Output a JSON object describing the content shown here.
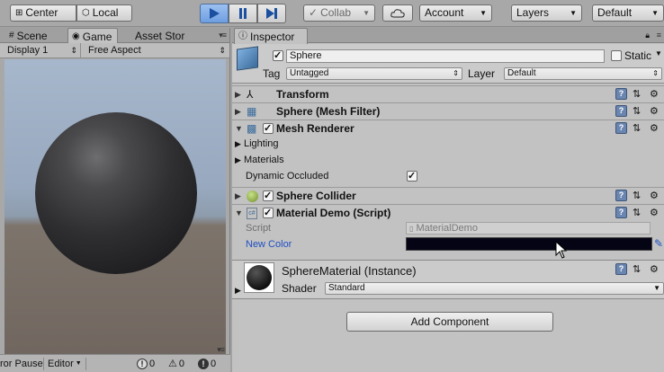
{
  "toolbar": {
    "center_label": "Center",
    "local_label": "Local",
    "collab_label": "Collab",
    "account_label": "Account",
    "layers_label": "Layers",
    "layout_label": "Default"
  },
  "game_panel": {
    "tabs": [
      "Scene",
      "Game",
      "Asset Stor"
    ],
    "display": "Display 1",
    "aspect": "Free Aspect",
    "status": {
      "clear_on_pause": "ror Pause",
      "editor": "Editor",
      "info_count": "0",
      "warn_count": "0",
      "error_count": "0"
    }
  },
  "inspector": {
    "tab": "Inspector",
    "object_name": "Sphere",
    "static_label": "Static",
    "tag_label": "Tag",
    "tag_value": "Untagged",
    "layer_label": "Layer",
    "layer_value": "Default",
    "components": {
      "transform": "Transform",
      "mesh_filter": "Sphere (Mesh Filter)",
      "mesh_renderer": "Mesh Renderer",
      "lighting": "Lighting",
      "materials": "Materials",
      "dynamic_occluded": "Dynamic Occluded",
      "sphere_collider": "Sphere Collider",
      "material_demo": "Material Demo (Script)",
      "script_label": "Script",
      "script_value": "MaterialDemo",
      "new_color_label": "New Color"
    },
    "material": {
      "name": "SphereMaterial (Instance)",
      "shader_label": "Shader",
      "shader_value": "Standard"
    },
    "add_component": "Add Component"
  },
  "colors": {
    "new_color": "#040414",
    "play_active": "#6f9ee0",
    "link_blue": "#1f4fc2"
  }
}
